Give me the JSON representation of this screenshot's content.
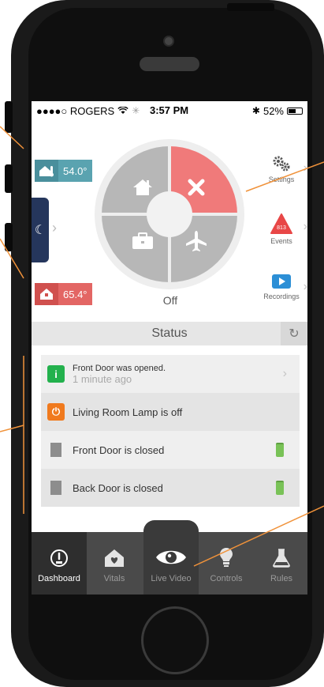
{
  "status_bar": {
    "carrier": "●●●●○ ROGERS",
    "time": "3:57 PM",
    "battery_pct": "52%"
  },
  "temperatures": {
    "inside": "54.0°",
    "outside": "65.4°"
  },
  "mode": {
    "current": "Off",
    "options": [
      "home",
      "away-off",
      "work",
      "vacation"
    ]
  },
  "side_menu": {
    "settings_label": "Settings",
    "events_label": "Events",
    "events_count": "813",
    "recordings_label": "Recordings"
  },
  "status": {
    "title": "Status",
    "items": [
      {
        "text": "Front Door was opened.",
        "sub": "1 minute ago",
        "icon": "info-icon"
      },
      {
        "text": "Living Room Lamp is off",
        "icon": "power-icon"
      },
      {
        "text": "Front Door is closed",
        "icon": "door-icon",
        "battery": "battery-full-icon"
      },
      {
        "text": "Back Door is closed",
        "icon": "door-icon",
        "battery": "battery-full-icon"
      }
    ]
  },
  "tabs": [
    {
      "label": "Dashboard",
      "icon": "gauge-icon",
      "active": true
    },
    {
      "label": "Vitals",
      "icon": "heart-house-icon",
      "active": false
    },
    {
      "label": "Live Video",
      "icon": "eye-icon",
      "active": false
    },
    {
      "label": "Controls",
      "icon": "bulb-icon",
      "active": false
    },
    {
      "label": "Rules",
      "icon": "flask-icon",
      "active": false
    }
  ],
  "colors": {
    "accent_red": "#f07a7a",
    "teal": "#5aa3b0",
    "navy": "#25365c",
    "green": "#23b14d",
    "orange": "#f07a1e",
    "callout": "#f0923a"
  }
}
